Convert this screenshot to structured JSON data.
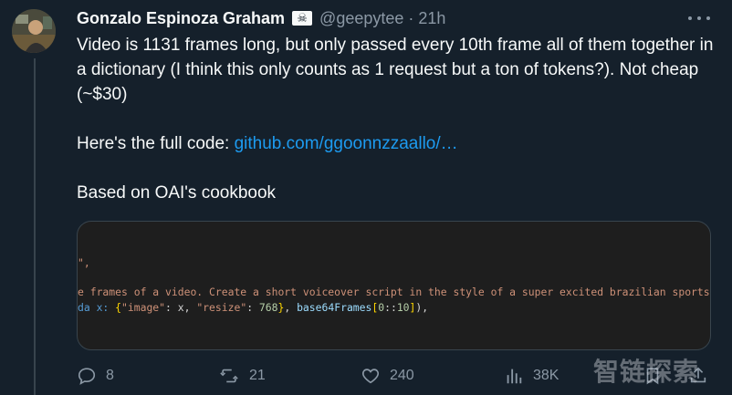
{
  "author": {
    "display_name": "Gonzalo Espinoza Graham",
    "badge": "☠",
    "handle": "@geepytee",
    "separator": "·",
    "time": "21h"
  },
  "tweet": {
    "line1": "Video is 1131 frames long, but only passed every 10th frame all of them together in a dictionary (I think this only counts as 1 request but a ton of tokens?). Not cheap (~$30)",
    "line2_prefix": "Here's the full code: ",
    "line2_link": "github.com/ggoonnzzaallo/…",
    "line3": "Based on OAI's cookbook"
  },
  "code_image": {
    "line1": "\",",
    "line2": "e frames of a video. Create a short voiceover script in the style of a super excited brazilian sports narra",
    "line3_a": "da x: ",
    "line3_b": "{\"image\"",
    "line3_c": ": x, ",
    "line3_d": "\"resize\"",
    "line3_e": ": ",
    "line3_f": "768",
    "line3_g": "}, base64Frames[",
    "line3_h": "0",
    "line3_i": "::",
    "line3_j": "10",
    "line3_k": "]),"
  },
  "actions": {
    "reply_count": "8",
    "retweet_count": "21",
    "like_count": "240",
    "view_count": "38K"
  },
  "watermark": "智链探索",
  "colors": {
    "background": "#15202b",
    "link": "#1d9bf0",
    "muted": "#8b98a5"
  }
}
